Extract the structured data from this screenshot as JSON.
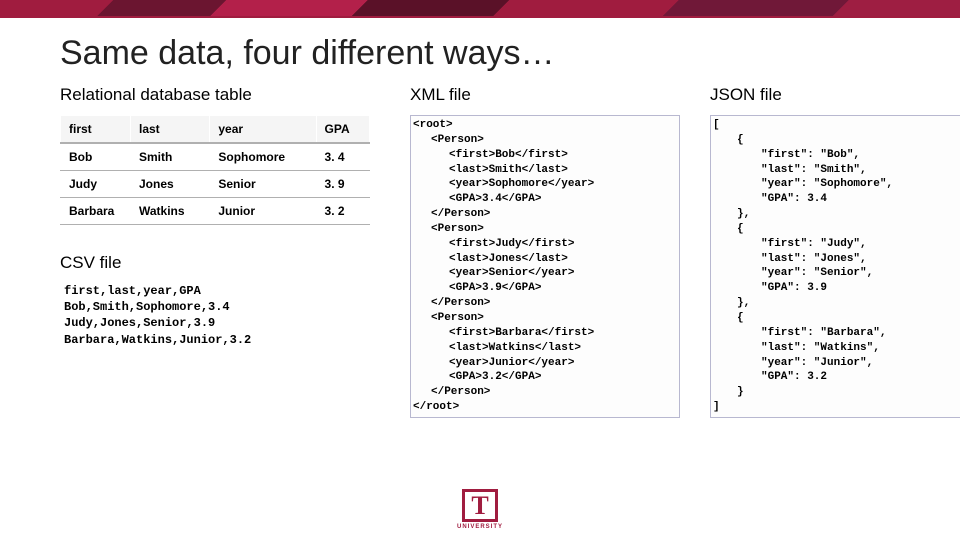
{
  "title": "Same data, four different ways…",
  "sections": {
    "relational": "Relational database table",
    "csv": "CSV file",
    "xml": "XML file",
    "json": "JSON file"
  },
  "table": {
    "headers": [
      "first",
      "last",
      "year",
      "GPA"
    ],
    "rows": [
      [
        "Bob",
        "Smith",
        "Sophomore",
        "3. 4"
      ],
      [
        "Judy",
        "Jones",
        "Senior",
        "3. 9"
      ],
      [
        "Barbara",
        "Watkins",
        "Junior",
        "3. 2"
      ]
    ]
  },
  "csv": "first,last,year,GPA\nBob,Smith,Sophomore,3.4\nJudy,Jones,Senior,3.9\nBarbara,Watkins,Junior,3.2",
  "xml": [
    {
      "i": 0,
      "t": "<root>"
    },
    {
      "i": 1,
      "t": "<Person>"
    },
    {
      "i": 2,
      "t": "<first>Bob</first>"
    },
    {
      "i": 2,
      "t": "<last>Smith</last>"
    },
    {
      "i": 2,
      "t": "<year>Sophomore</year>"
    },
    {
      "i": 2,
      "t": "<GPA>3.4</GPA>"
    },
    {
      "i": 1,
      "t": "</Person>"
    },
    {
      "i": 1,
      "t": "<Person>"
    },
    {
      "i": 2,
      "t": "<first>Judy</first>"
    },
    {
      "i": 2,
      "t": "<last>Jones</last>"
    },
    {
      "i": 2,
      "t": "<year>Senior</year>"
    },
    {
      "i": 2,
      "t": "<GPA>3.9</GPA>"
    },
    {
      "i": 1,
      "t": "</Person>"
    },
    {
      "i": 1,
      "t": "<Person>"
    },
    {
      "i": 2,
      "t": "<first>Barbara</first>"
    },
    {
      "i": 2,
      "t": "<last>Watkins</last>"
    },
    {
      "i": 2,
      "t": "<year>Junior</year>"
    },
    {
      "i": 2,
      "t": "<GPA>3.2</GPA>"
    },
    {
      "i": 1,
      "t": "</Person>"
    },
    {
      "i": 0,
      "t": "</root>"
    }
  ],
  "json": [
    {
      "i": 0,
      "t": "["
    },
    {
      "i": 1,
      "t": "{"
    },
    {
      "i": 2,
      "t": "\"first\": \"Bob\","
    },
    {
      "i": 2,
      "t": "\"last\": \"Smith\","
    },
    {
      "i": 2,
      "t": "\"year\": \"Sophomore\","
    },
    {
      "i": 2,
      "t": "\"GPA\": 3.4"
    },
    {
      "i": 1,
      "t": "},"
    },
    {
      "i": 1,
      "t": "{"
    },
    {
      "i": 2,
      "t": "\"first\": \"Judy\","
    },
    {
      "i": 2,
      "t": "\"last\": \"Jones\","
    },
    {
      "i": 2,
      "t": "\"year\": \"Senior\","
    },
    {
      "i": 2,
      "t": "\"GPA\": 3.9"
    },
    {
      "i": 1,
      "t": "},"
    },
    {
      "i": 1,
      "t": "{"
    },
    {
      "i": 2,
      "t": "\"first\": \"Barbara\","
    },
    {
      "i": 2,
      "t": "\"last\": \"Watkins\","
    },
    {
      "i": 2,
      "t": "\"year\": \"Junior\","
    },
    {
      "i": 2,
      "t": "\"GPA\": 3.2"
    },
    {
      "i": 1,
      "t": "}"
    },
    {
      "i": 0,
      "t": "]"
    }
  ],
  "logo": {
    "letter": "T",
    "word": "UNIVERSITY"
  }
}
